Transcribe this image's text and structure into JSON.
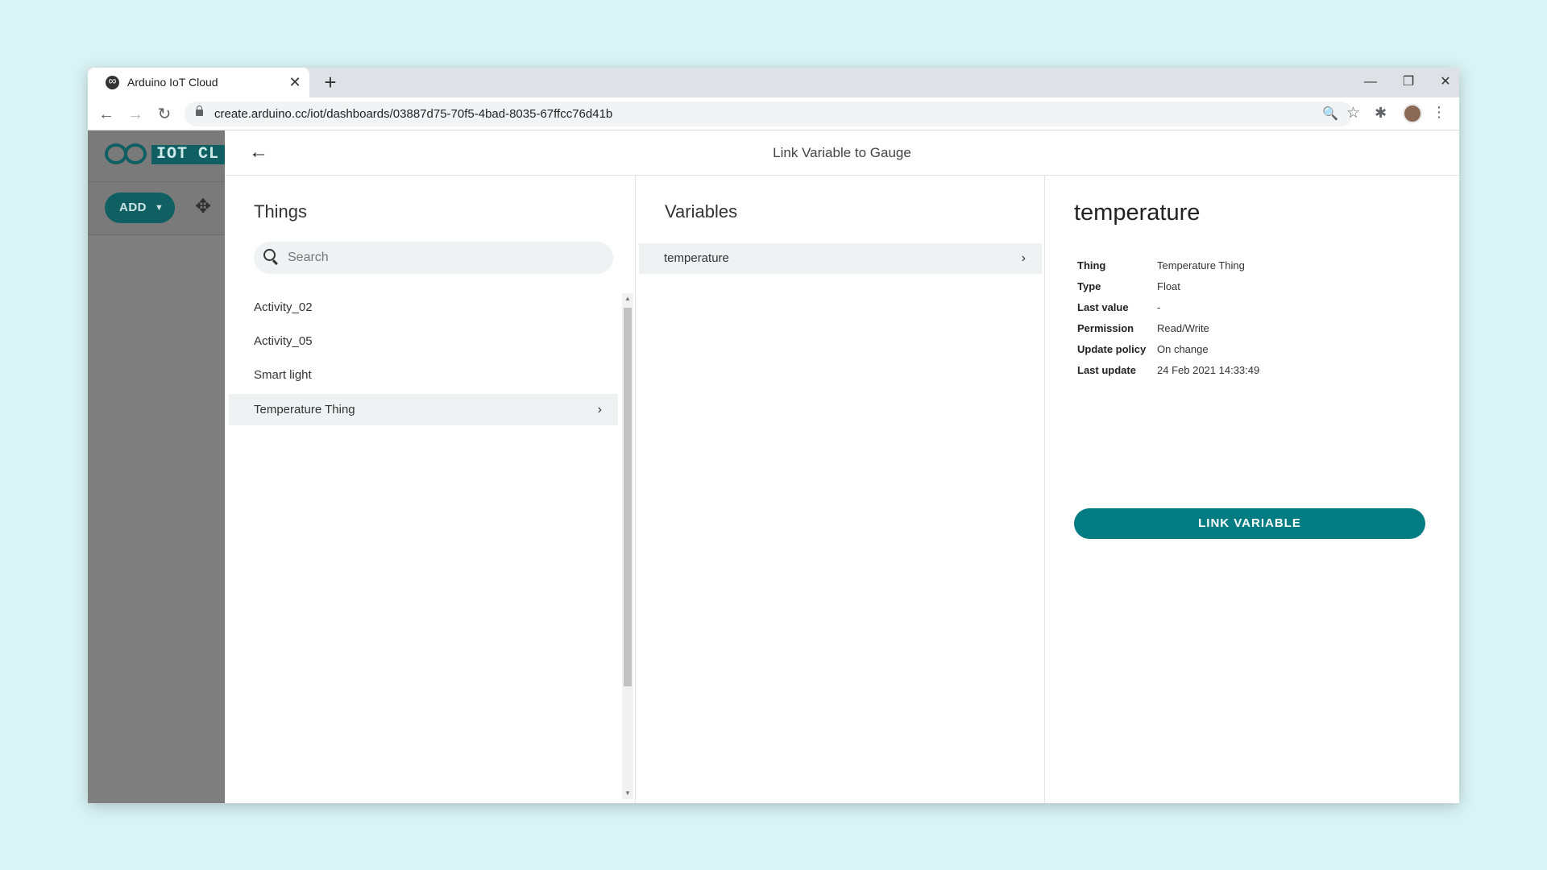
{
  "browser": {
    "tab_title": "Arduino IoT Cloud",
    "url": "create.arduino.cc/iot/dashboards/03887d75-70f5-4bad-8035-67ffcc76d41b"
  },
  "app": {
    "logo_text": "IOT CL",
    "add_label": "ADD",
    "accent_color": "#0f5f63"
  },
  "modal": {
    "title": "Link Variable to Gauge",
    "things": {
      "heading": "Things",
      "search_placeholder": "Search",
      "items": [
        "Activity_02",
        "Activity_05",
        "Smart light",
        "Temperature Thing"
      ]
    },
    "variables": {
      "heading": "Variables",
      "items": [
        "temperature"
      ]
    },
    "detail": {
      "title": "temperature",
      "props": [
        {
          "key": "Thing",
          "value": "Temperature Thing"
        },
        {
          "key": "Type",
          "value": "Float"
        },
        {
          "key": "Last value",
          "value": "-"
        },
        {
          "key": "Permission",
          "value": "Read/Write"
        },
        {
          "key": "Update policy",
          "value": "On change"
        },
        {
          "key": "Last update",
          "value": "24 Feb 2021 14:33:49"
        }
      ],
      "link_button": "LINK VARIABLE",
      "button_color": "#007c82"
    }
  }
}
